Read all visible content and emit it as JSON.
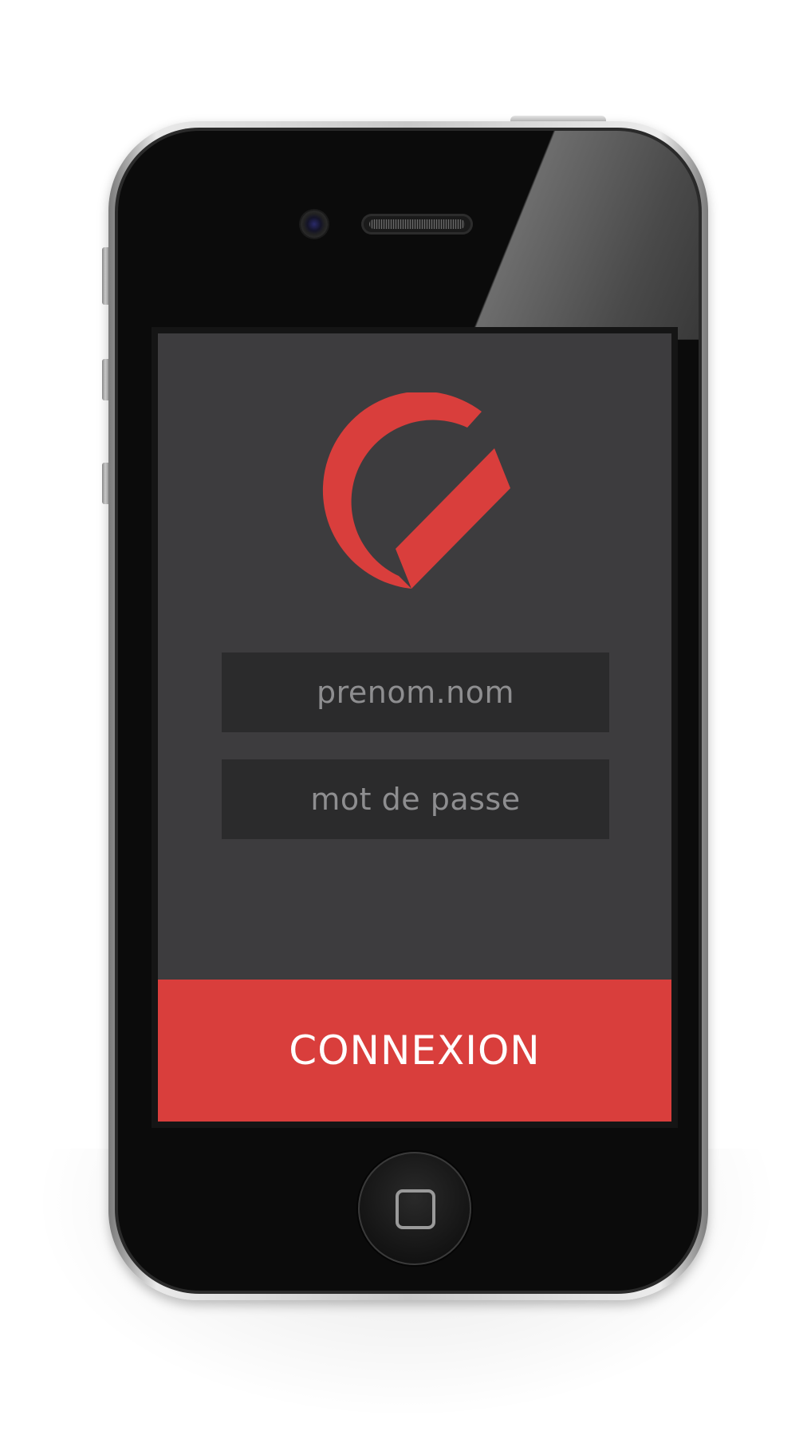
{
  "login": {
    "username_placeholder": "prenom.nom",
    "password_placeholder": "mot de passe",
    "connect_label": "CONNEXION"
  },
  "colors": {
    "accent": "#d93e3c",
    "screen_background": "#3d3c3e",
    "field_background": "#2b2b2c",
    "placeholder_text": "#8e8e90"
  },
  "icons": {
    "logo": "red-check-circle-logo",
    "home": "home-button-square"
  }
}
